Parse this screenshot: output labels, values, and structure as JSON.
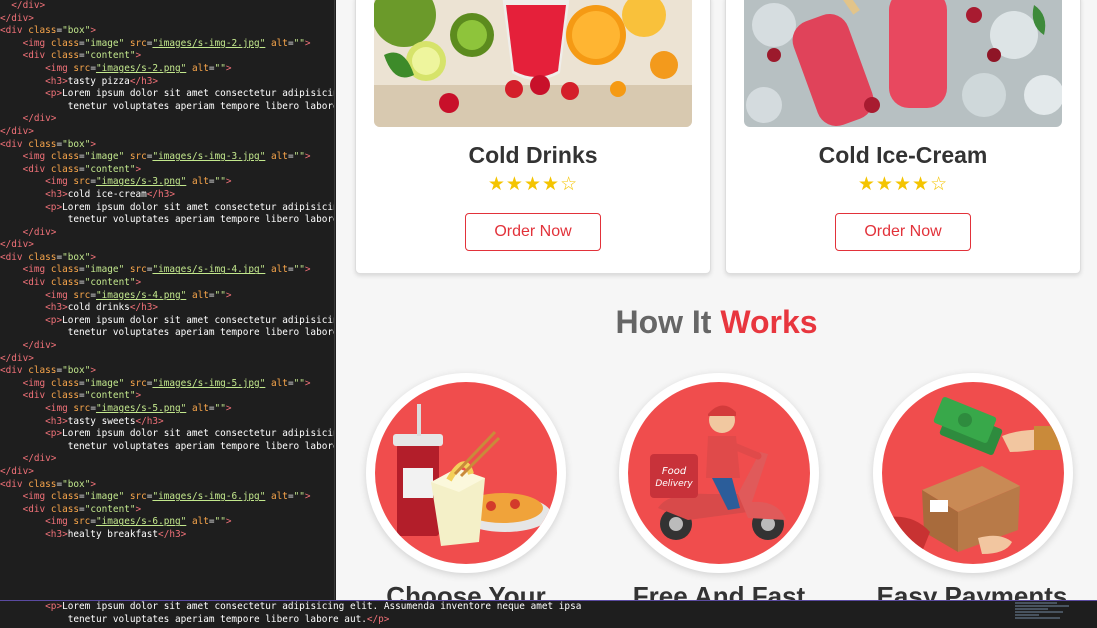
{
  "editor": {
    "lines": [
      [
        [
          "tk-tag",
          "  </div>"
        ]
      ],
      [
        [
          "tk-tag",
          "</div>"
        ]
      ],
      [
        [
          "tk-tag",
          "<div "
        ],
        [
          "tk-attr",
          "class"
        ],
        [
          "tk-eq",
          "="
        ],
        [
          "tk-str",
          "\"box\""
        ],
        [
          "tk-tag",
          ">"
        ]
      ],
      [
        [
          "tk-t",
          "    "
        ],
        [
          "tk-tag",
          "<img "
        ],
        [
          "tk-attr",
          "class"
        ],
        [
          "tk-eq",
          "="
        ],
        [
          "tk-str",
          "\"image\" "
        ],
        [
          "tk-attr",
          "src"
        ],
        [
          "tk-eq",
          "="
        ],
        [
          "tk-link",
          "\"images/s-img-2.jpg\""
        ],
        [
          "tk-t",
          " "
        ],
        [
          "tk-attr",
          "alt"
        ],
        [
          "tk-eq",
          "="
        ],
        [
          "tk-str",
          "\"\""
        ],
        [
          "tk-tag",
          ">"
        ]
      ],
      [
        [
          "tk-t",
          "    "
        ],
        [
          "tk-tag",
          "<div "
        ],
        [
          "tk-attr",
          "class"
        ],
        [
          "tk-eq",
          "="
        ],
        [
          "tk-str",
          "\"content\""
        ],
        [
          "tk-tag",
          ">"
        ]
      ],
      [
        [
          "tk-t",
          "        "
        ],
        [
          "tk-tag",
          "<img "
        ],
        [
          "tk-attr",
          "src"
        ],
        [
          "tk-eq",
          "="
        ],
        [
          "tk-link",
          "\"images/s-2.png\""
        ],
        [
          "tk-t",
          " "
        ],
        [
          "tk-attr",
          "alt"
        ],
        [
          "tk-eq",
          "="
        ],
        [
          "tk-str",
          "\"\""
        ],
        [
          "tk-tag",
          ">"
        ]
      ],
      [
        [
          "tk-t",
          "        "
        ],
        [
          "tk-tag",
          "<h3>"
        ],
        [
          "tk-txt",
          "tasty pizza"
        ],
        [
          "tk-tag",
          "</h3>"
        ]
      ],
      [
        [
          "tk-t",
          "        "
        ],
        [
          "tk-tag",
          "<p>"
        ],
        [
          "tk-txt",
          "Lorem ipsum dolor sit amet consectetur adipisicing"
        ]
      ],
      [
        [
          "tk-txt",
          "            tenetur voluptates aperiam tempore libero labore"
        ]
      ],
      [
        [
          "tk-t",
          "    "
        ],
        [
          "tk-tag",
          "</div>"
        ]
      ],
      [
        [
          "tk-tag",
          "</div>"
        ]
      ],
      [
        [
          "tk-tag",
          "<div "
        ],
        [
          "tk-attr",
          "class"
        ],
        [
          "tk-eq",
          "="
        ],
        [
          "tk-str",
          "\"box\""
        ],
        [
          "tk-tag",
          ">"
        ]
      ],
      [
        [
          "tk-t",
          "    "
        ],
        [
          "tk-tag",
          "<img "
        ],
        [
          "tk-attr",
          "class"
        ],
        [
          "tk-eq",
          "="
        ],
        [
          "tk-str",
          "\"image\" "
        ],
        [
          "tk-attr",
          "src"
        ],
        [
          "tk-eq",
          "="
        ],
        [
          "tk-link",
          "\"images/s-img-3.jpg\""
        ],
        [
          "tk-t",
          " "
        ],
        [
          "tk-attr",
          "alt"
        ],
        [
          "tk-eq",
          "="
        ],
        [
          "tk-str",
          "\"\""
        ],
        [
          "tk-tag",
          ">"
        ]
      ],
      [
        [
          "tk-t",
          "    "
        ],
        [
          "tk-tag",
          "<div "
        ],
        [
          "tk-attr",
          "class"
        ],
        [
          "tk-eq",
          "="
        ],
        [
          "tk-str",
          "\"content\""
        ],
        [
          "tk-tag",
          ">"
        ]
      ],
      [
        [
          "tk-t",
          "        "
        ],
        [
          "tk-tag",
          "<img "
        ],
        [
          "tk-attr",
          "src"
        ],
        [
          "tk-eq",
          "="
        ],
        [
          "tk-link",
          "\"images/s-3.png\""
        ],
        [
          "tk-t",
          " "
        ],
        [
          "tk-attr",
          "alt"
        ],
        [
          "tk-eq",
          "="
        ],
        [
          "tk-str",
          "\"\""
        ],
        [
          "tk-tag",
          ">"
        ]
      ],
      [
        [
          "tk-t",
          "        "
        ],
        [
          "tk-tag",
          "<h3>"
        ],
        [
          "tk-txt",
          "cold ice-cream"
        ],
        [
          "tk-tag",
          "</h3>"
        ]
      ],
      [
        [
          "tk-t",
          "        "
        ],
        [
          "tk-tag",
          "<p>"
        ],
        [
          "tk-txt",
          "Lorem ipsum dolor sit amet consectetur adipisicing"
        ]
      ],
      [
        [
          "tk-txt",
          "            tenetur voluptates aperiam tempore libero labore"
        ]
      ],
      [
        [
          "tk-t",
          "    "
        ],
        [
          "tk-tag",
          "</div>"
        ]
      ],
      [
        [
          "tk-tag",
          "</div>"
        ]
      ],
      [
        [
          "tk-tag",
          "<div "
        ],
        [
          "tk-attr",
          "class"
        ],
        [
          "tk-eq",
          "="
        ],
        [
          "tk-str",
          "\"box\""
        ],
        [
          "tk-tag",
          ">"
        ]
      ],
      [
        [
          "tk-t",
          "    "
        ],
        [
          "tk-tag",
          "<img "
        ],
        [
          "tk-attr",
          "class"
        ],
        [
          "tk-eq",
          "="
        ],
        [
          "tk-str",
          "\"image\" "
        ],
        [
          "tk-attr",
          "src"
        ],
        [
          "tk-eq",
          "="
        ],
        [
          "tk-link",
          "\"images/s-img-4.jpg\""
        ],
        [
          "tk-t",
          " "
        ],
        [
          "tk-attr",
          "alt"
        ],
        [
          "tk-eq",
          "="
        ],
        [
          "tk-str",
          "\"\""
        ],
        [
          "tk-tag",
          ">"
        ]
      ],
      [
        [
          "tk-t",
          "    "
        ],
        [
          "tk-tag",
          "<div "
        ],
        [
          "tk-attr",
          "class"
        ],
        [
          "tk-eq",
          "="
        ],
        [
          "tk-str",
          "\"content\""
        ],
        [
          "tk-tag",
          ">"
        ]
      ],
      [
        [
          "tk-t",
          "        "
        ],
        [
          "tk-tag",
          "<img "
        ],
        [
          "tk-attr",
          "src"
        ],
        [
          "tk-eq",
          "="
        ],
        [
          "tk-link",
          "\"images/s-4.png\""
        ],
        [
          "tk-t",
          " "
        ],
        [
          "tk-attr",
          "alt"
        ],
        [
          "tk-eq",
          "="
        ],
        [
          "tk-str",
          "\"\""
        ],
        [
          "tk-tag",
          ">"
        ]
      ],
      [
        [
          "tk-t",
          "        "
        ],
        [
          "tk-tag",
          "<h3>"
        ],
        [
          "tk-txt",
          "cold drinks"
        ],
        [
          "tk-tag",
          "</h3>"
        ]
      ],
      [
        [
          "tk-t",
          "        "
        ],
        [
          "tk-tag",
          "<p>"
        ],
        [
          "tk-txt",
          "Lorem ipsum dolor sit amet consectetur adipisicing"
        ]
      ],
      [
        [
          "tk-txt",
          "            tenetur voluptates aperiam tempore libero labore"
        ]
      ],
      [
        [
          "tk-t",
          "    "
        ],
        [
          "tk-tag",
          "</div>"
        ]
      ],
      [
        [
          "tk-tag",
          "</div>"
        ]
      ],
      [
        [
          "tk-tag",
          "<div "
        ],
        [
          "tk-attr",
          "class"
        ],
        [
          "tk-eq",
          "="
        ],
        [
          "tk-str",
          "\"box\""
        ],
        [
          "tk-tag",
          ">"
        ]
      ],
      [
        [
          "tk-t",
          "    "
        ],
        [
          "tk-tag",
          "<img "
        ],
        [
          "tk-attr",
          "class"
        ],
        [
          "tk-eq",
          "="
        ],
        [
          "tk-str",
          "\"image\" "
        ],
        [
          "tk-attr",
          "src"
        ],
        [
          "tk-eq",
          "="
        ],
        [
          "tk-link",
          "\"images/s-img-5.jpg\""
        ],
        [
          "tk-t",
          " "
        ],
        [
          "tk-attr",
          "alt"
        ],
        [
          "tk-eq",
          "="
        ],
        [
          "tk-str",
          "\"\""
        ],
        [
          "tk-tag",
          ">"
        ]
      ],
      [
        [
          "tk-t",
          "    "
        ],
        [
          "tk-tag",
          "<div "
        ],
        [
          "tk-attr",
          "class"
        ],
        [
          "tk-eq",
          "="
        ],
        [
          "tk-str",
          "\"content\""
        ],
        [
          "tk-tag",
          ">"
        ]
      ],
      [
        [
          "tk-t",
          "        "
        ],
        [
          "tk-tag",
          "<img "
        ],
        [
          "tk-attr",
          "src"
        ],
        [
          "tk-eq",
          "="
        ],
        [
          "tk-link",
          "\"images/s-5.png\""
        ],
        [
          "tk-t",
          " "
        ],
        [
          "tk-attr",
          "alt"
        ],
        [
          "tk-eq",
          "="
        ],
        [
          "tk-str",
          "\"\""
        ],
        [
          "tk-tag",
          ">"
        ]
      ],
      [
        [
          "tk-t",
          "        "
        ],
        [
          "tk-tag",
          "<h3>"
        ],
        [
          "tk-txt",
          "tasty sweets"
        ],
        [
          "tk-tag",
          "</h3>"
        ]
      ],
      [
        [
          "tk-t",
          "        "
        ],
        [
          "tk-tag",
          "<p>"
        ],
        [
          "tk-txt",
          "Lorem ipsum dolor sit amet consectetur adipisicing"
        ]
      ],
      [
        [
          "tk-txt",
          "            tenetur voluptates aperiam tempore libero labore"
        ]
      ],
      [
        [
          "tk-t",
          "    "
        ],
        [
          "tk-tag",
          "</div>"
        ]
      ],
      [
        [
          "tk-tag",
          "</div>"
        ]
      ],
      [
        [
          "tk-tag",
          "<div "
        ],
        [
          "tk-attr",
          "class"
        ],
        [
          "tk-eq",
          "="
        ],
        [
          "tk-str",
          "\"box\""
        ],
        [
          "tk-tag",
          ">"
        ]
      ],
      [
        [
          "tk-t",
          "    "
        ],
        [
          "tk-tag",
          "<img "
        ],
        [
          "tk-attr",
          "class"
        ],
        [
          "tk-eq",
          "="
        ],
        [
          "tk-str",
          "\"image\" "
        ],
        [
          "tk-attr",
          "src"
        ],
        [
          "tk-eq",
          "="
        ],
        [
          "tk-link",
          "\"images/s-img-6.jpg\""
        ],
        [
          "tk-t",
          " "
        ],
        [
          "tk-attr",
          "alt"
        ],
        [
          "tk-eq",
          "="
        ],
        [
          "tk-str",
          "\"\""
        ],
        [
          "tk-tag",
          ">"
        ]
      ],
      [
        [
          "tk-t",
          "    "
        ],
        [
          "tk-tag",
          "<div "
        ],
        [
          "tk-attr",
          "class"
        ],
        [
          "tk-eq",
          "="
        ],
        [
          "tk-str",
          "\"content\""
        ],
        [
          "tk-tag",
          ">"
        ]
      ],
      [
        [
          "tk-t",
          "        "
        ],
        [
          "tk-tag",
          "<img "
        ],
        [
          "tk-attr",
          "src"
        ],
        [
          "tk-eq",
          "="
        ],
        [
          "tk-link",
          "\"images/s-6.png\""
        ],
        [
          "tk-t",
          " "
        ],
        [
          "tk-attr",
          "alt"
        ],
        [
          "tk-eq",
          "="
        ],
        [
          "tk-str",
          "\"\""
        ],
        [
          "tk-tag",
          ">"
        ]
      ],
      [
        [
          "tk-t",
          "        "
        ],
        [
          "tk-tag",
          "<h3>"
        ],
        [
          "tk-txt",
          "healty breakfast"
        ],
        [
          "tk-tag",
          "</h3>"
        ]
      ]
    ],
    "overflow_lines": [
      [
        [
          "tk-t",
          "        "
        ],
        [
          "tk-tag",
          "<p>"
        ],
        [
          "tk-txt",
          "Lorem ipsum dolor sit amet consectetur adipisicing elit. Assumenda inventore neque amet ipsa"
        ]
      ],
      [
        [
          "tk-txt",
          "            tenetur voluptates aperiam tempore libero labore aut."
        ],
        [
          "tk-tag",
          "</p>"
        ]
      ]
    ]
  },
  "preview": {
    "cards": [
      {
        "title": "Cold Drinks",
        "rating": 4,
        "max_rating": 5,
        "button": "Order Now"
      },
      {
        "title": "Cold Ice-Cream",
        "rating": 4,
        "max_rating": 5,
        "button": "Order Now"
      }
    ],
    "how": {
      "heading_part1": "How It",
      "heading_part2": "Works"
    },
    "steps": [
      {
        "title": "Choose Your",
        "icon": "fast-food-icon"
      },
      {
        "title": "Free And Fast",
        "icon": "delivery-scooter-icon"
      },
      {
        "title": "Easy Payments",
        "icon": "payment-parcel-icon"
      }
    ]
  },
  "colors": {
    "accent": "#e8363e",
    "star": "#f4c400",
    "editor_bg": "#1e1e1e"
  }
}
